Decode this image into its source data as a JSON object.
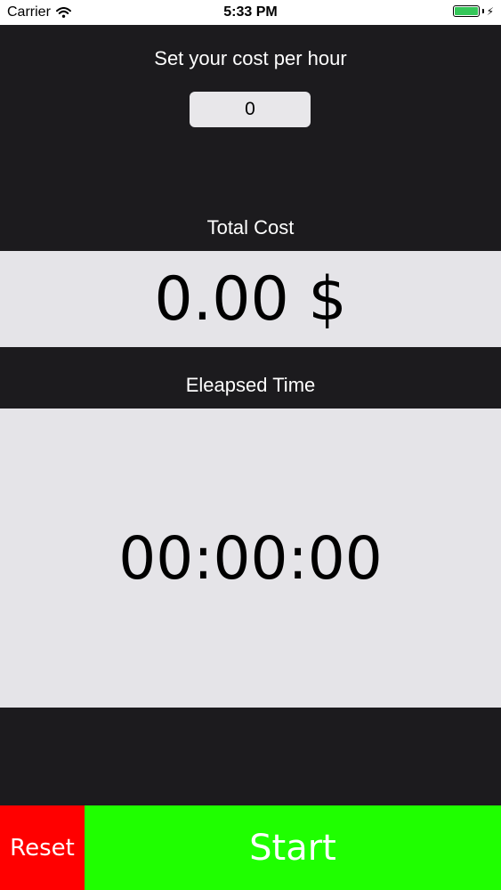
{
  "status_bar": {
    "carrier": "Carrier",
    "time": "5:33 PM",
    "wifi_icon": "wifi-icon",
    "battery_icon": "battery-icon",
    "charging_icon": "bolt-icon",
    "battery_color": "#35c759",
    "battery_level": 1.0
  },
  "cost_per_hour": {
    "label": "Set your cost per hour",
    "value": "0"
  },
  "total_cost": {
    "label": "Total Cost",
    "value": "0.00 $"
  },
  "elapsed_time": {
    "label": "Eleapsed Time",
    "value": "00:00:00"
  },
  "actions": {
    "reset_label": "Reset",
    "start_label": "Start",
    "reset_color": "#ff0000",
    "start_color": "#1fff00"
  }
}
